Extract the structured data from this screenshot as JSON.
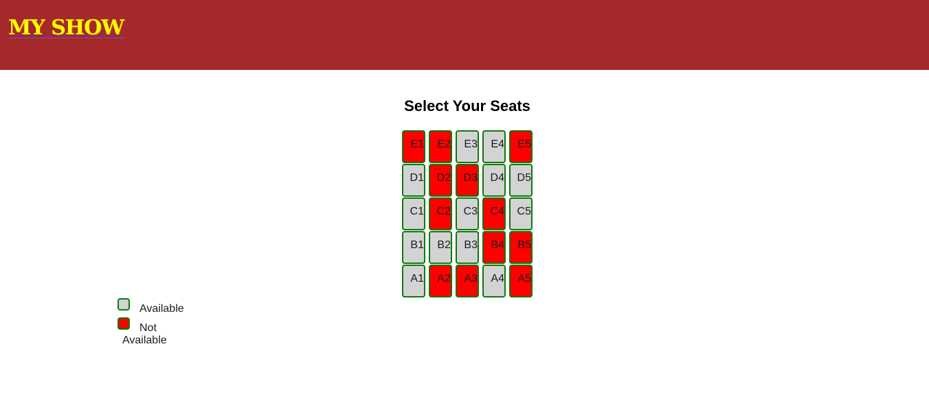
{
  "header": {
    "logo": "MY SHOW",
    "background_color": "#a5282b",
    "logo_color": "#ffff00"
  },
  "main": {
    "title": "Select Your Seats"
  },
  "colors": {
    "available": "#d3d3d3",
    "unavailable": "#ff0000",
    "seat_border": "#0b7a0b"
  },
  "seat_rows": [
    {
      "row": "E",
      "seats": [
        {
          "label": "E1",
          "available": false
        },
        {
          "label": "E2",
          "available": false
        },
        {
          "label": "E3",
          "available": true
        },
        {
          "label": "E4",
          "available": true
        },
        {
          "label": "E5",
          "available": false
        }
      ]
    },
    {
      "row": "D",
      "seats": [
        {
          "label": "D1",
          "available": true
        },
        {
          "label": "D2",
          "available": false
        },
        {
          "label": "D3",
          "available": false
        },
        {
          "label": "D4",
          "available": true
        },
        {
          "label": "D5",
          "available": true
        }
      ]
    },
    {
      "row": "C",
      "seats": [
        {
          "label": "C1",
          "available": true
        },
        {
          "label": "C2",
          "available": false
        },
        {
          "label": "C3",
          "available": true
        },
        {
          "label": "C4",
          "available": false
        },
        {
          "label": "C5",
          "available": true
        }
      ]
    },
    {
      "row": "B",
      "seats": [
        {
          "label": "B1",
          "available": true
        },
        {
          "label": "B2",
          "available": true
        },
        {
          "label": "B3",
          "available": true
        },
        {
          "label": "B4",
          "available": false
        },
        {
          "label": "B5",
          "available": false
        }
      ]
    },
    {
      "row": "A",
      "seats": [
        {
          "label": "A1",
          "available": true
        },
        {
          "label": "A2",
          "available": false
        },
        {
          "label": "A3",
          "available": false
        },
        {
          "label": "A4",
          "available": true
        },
        {
          "label": "A5",
          "available": false
        }
      ]
    }
  ],
  "legend": {
    "available_label": "Available",
    "unavailable_label": "Not Available"
  }
}
